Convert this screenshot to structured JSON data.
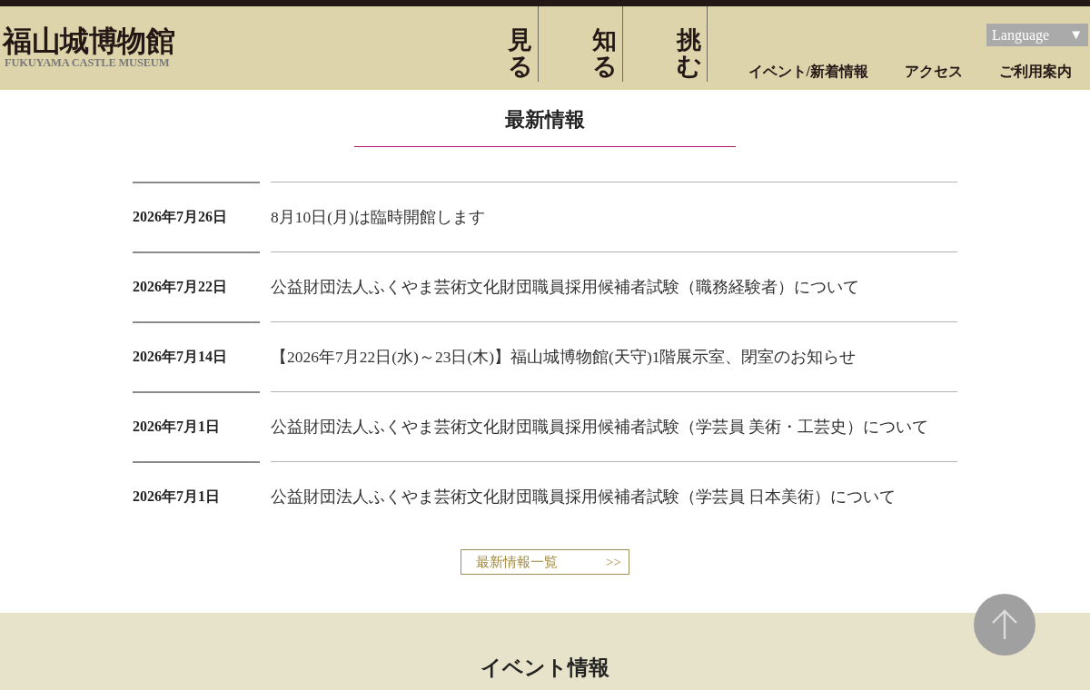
{
  "header": {
    "logo": {
      "title": "福山城博物館",
      "subtitle": "FUKUYAMA CASTLE MUSEUM"
    },
    "main_nav": [
      "見る",
      "知る",
      "挑む"
    ],
    "language_menu": {
      "label": "Language",
      "caret": "▼"
    },
    "sub_nav": [
      "イベント/新着情報",
      "アクセス",
      "ご利用案内"
    ]
  },
  "news": {
    "title": "最新情報",
    "items": [
      {
        "date": "2026年7月26日",
        "title": "8月10日(月)は臨時開館します"
      },
      {
        "date": "2026年7月22日",
        "title": "公益財団法人ふくやま芸術文化財団職員採用候補者試験（職務経験者）について"
      },
      {
        "date": "2026年7月14日",
        "title": "【2026年7月22日(水)～23日(木)】福山城博物館(天守)1階展示室、閉室のお知らせ"
      },
      {
        "date": "2026年7月1日",
        "title": "公益財団法人ふくやま芸術文化財団職員採用候補者試験（学芸員 美術・工芸史）について"
      },
      {
        "date": "2026年7月1日",
        "title": "公益財団法人ふくやま芸術文化財団職員採用候補者試験（学芸員 日本美術）について"
      }
    ],
    "more_button": {
      "label": "最新情報一覧",
      "arrow": ">>"
    }
  },
  "events": {
    "title": "イベント情報"
  }
}
